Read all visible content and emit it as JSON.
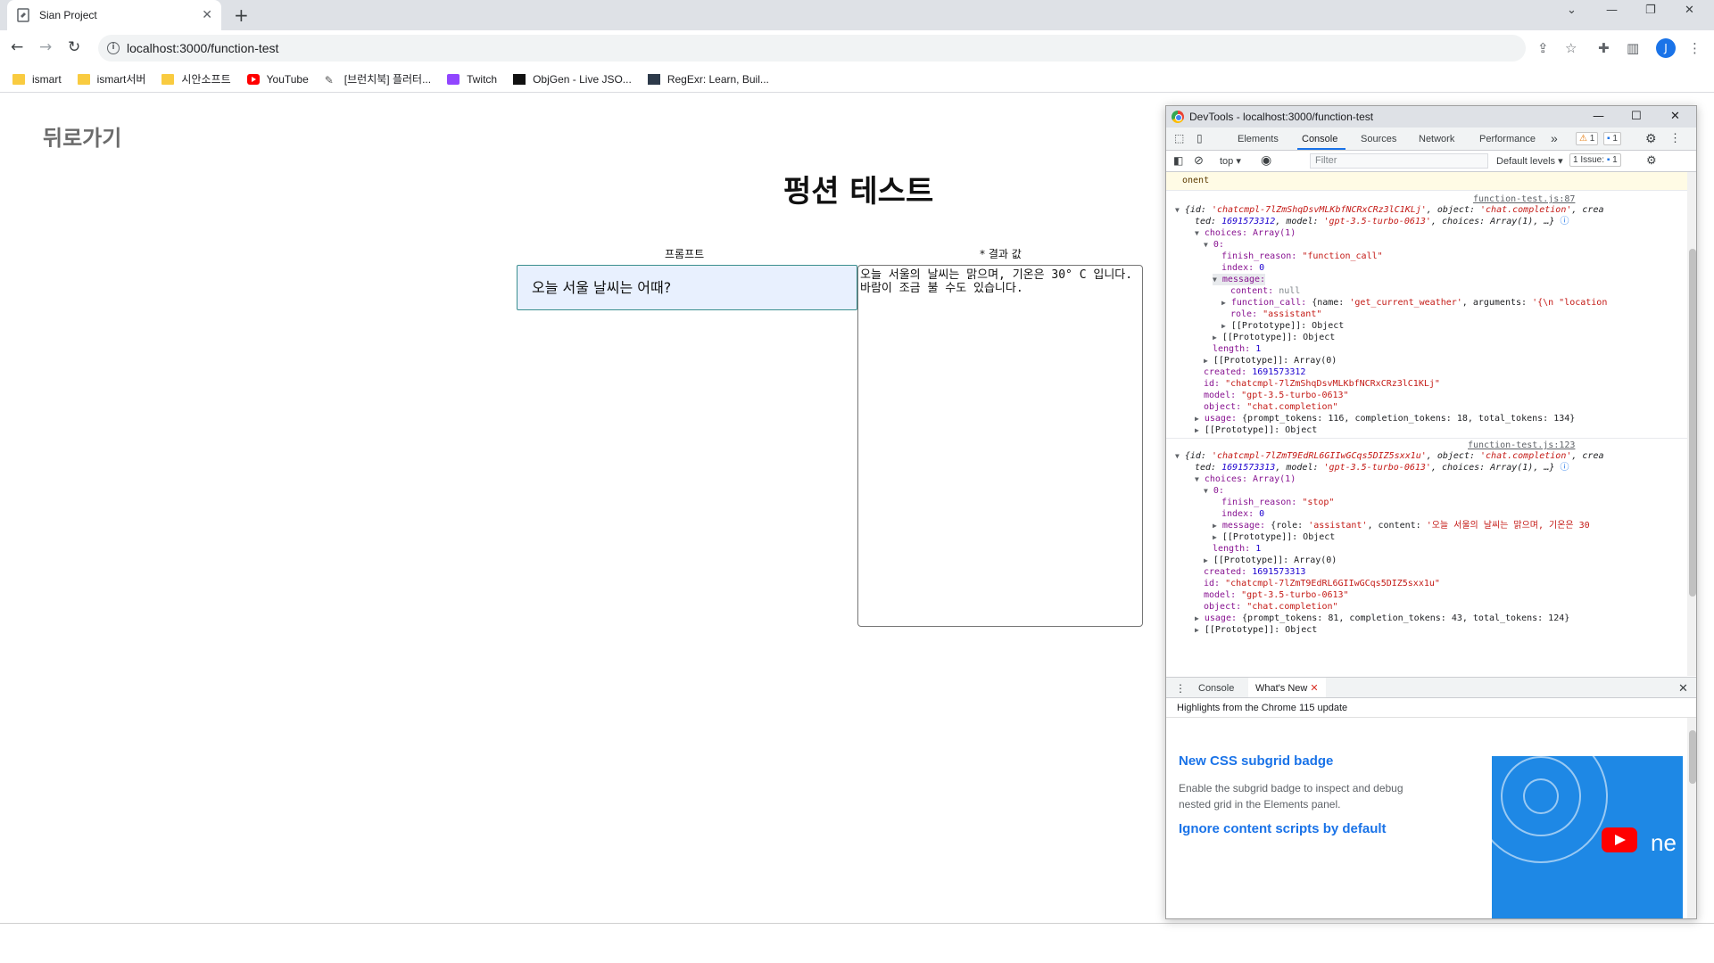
{
  "browser": {
    "tab_title": "Sian Project",
    "tab_close": "✕",
    "new_tab": "+",
    "url": "localhost:3000/function-test",
    "window_controls": [
      "⌄",
      "—",
      "❐",
      "✕"
    ],
    "toolbar_icons": [
      "share-icon",
      "star-icon",
      "extensions-icon",
      "side-panel-icon"
    ],
    "avatar_letter": "J",
    "menu": "⋮"
  },
  "bookmarks": [
    {
      "label": "ismart",
      "icon": "folder-icon"
    },
    {
      "label": "ismart서버",
      "icon": "folder-icon"
    },
    {
      "label": "시안소프트",
      "icon": "folder-icon"
    },
    {
      "label": "YouTube",
      "icon": "youtube-icon"
    },
    {
      "label": "[브런치북] 플러터...",
      "icon": "pen-icon"
    },
    {
      "label": "Twitch",
      "icon": "twitch-icon"
    },
    {
      "label": "ObjGen - Live JSO...",
      "icon": "objgen-icon"
    },
    {
      "label": "RegExr: Learn, Buil...",
      "icon": "regexr-icon"
    }
  ],
  "page": {
    "back_link": "뒤로가기",
    "title": "펑션 테스트",
    "prompt_label": "프롬프트",
    "result_label": "* 결과 값",
    "prompt_value": "오늘 서울 날씨는 어때?",
    "result_value": "오늘 서울의 날씨는 맑으며, 기온은 30° C 입니다. 바람이 조금 불 수도 있습니다."
  },
  "devtools": {
    "window_title": "DevTools - localhost:3000/function-test",
    "tabs": [
      "Elements",
      "Console",
      "Sources",
      "Network",
      "Performance"
    ],
    "active_tab": "Console",
    "more_tabs": "»",
    "warnings_count": "1",
    "messages_count": "1",
    "context": "top",
    "filter_placeholder": "Filter",
    "levels": "Default levels",
    "issues": "1 Issue:",
    "issues_count": "1",
    "console_top_fragment": "onent",
    "log1": {
      "source": "function-test.js:87",
      "summary_a": "{id: ",
      "summary_id": "'chatcmpl-7lZmShqDsvMLKbfNCRxCRz3lC1KLj'",
      "summary_b": ", object: ",
      "summary_obj": "'chat.completion'",
      "summary_c": ", crea",
      "summary_line2a": "ted: ",
      "summary_created": "1691573312",
      "summary_line2b": ", model: ",
      "summary_model": "'gpt-3.5-turbo-0613'",
      "summary_line2c": ", choices: Array(1), …}",
      "choices": "choices: Array(1)",
      "idx0": "0:",
      "finish_reason_key": "finish_reason:",
      "finish_reason": "\"function_call\"",
      "index_key": "index:",
      "index": "0",
      "message_key": "message:",
      "content_key": "content:",
      "content": "null",
      "function_call_key": "function_call:",
      "function_call_a": "{name: ",
      "function_call_name": "'get_current_weather'",
      "function_call_b": ", arguments: ",
      "function_call_args": "'{\\n  \"location",
      "role_key": "role:",
      "role": "\"assistant\"",
      "proto_object": "[[Prototype]]: Object",
      "length_key": "length:",
      "length": "1",
      "proto_array": "[[Prototype]]: Array(0)",
      "created_key": "created:",
      "created": "1691573312",
      "id_key": "id:",
      "id": "\"chatcmpl-7lZmShqDsvMLKbfNCRxCRz3lC1KLj\"",
      "model_key": "model:",
      "model": "\"gpt-3.5-turbo-0613\"",
      "object_key": "object:",
      "object": "\"chat.completion\"",
      "usage_key": "usage:",
      "usage": "{prompt_tokens: 116, completion_tokens: 18, total_tokens: 134}"
    },
    "log2": {
      "source": "function-test.js:123",
      "summary_a": "{id: ",
      "summary_id": "'chatcmpl-7lZmT9EdRL6GIIwGCqs5DIZ5sxx1u'",
      "summary_b": ", object: ",
      "summary_obj": "'chat.completion'",
      "summary_c": ", crea",
      "summary_line2a": "ted: ",
      "summary_created": "1691573313",
      "summary_line2b": ", model: ",
      "summary_model": "'gpt-3.5-turbo-0613'",
      "summary_line2c": ", choices: Array(1), …}",
      "choices": "choices: Array(1)",
      "idx0": "0:",
      "finish_reason_key": "finish_reason:",
      "finish_reason": "\"stop\"",
      "index_key": "index:",
      "index": "0",
      "message_key": "message:",
      "message_a": "{role: ",
      "message_role": "'assistant'",
      "message_b": ", content: ",
      "message_content": "'오늘 서울의 날씨는 맑으며, 기온은 30",
      "proto_object": "[[Prototype]]: Object",
      "length_key": "length:",
      "length": "1",
      "proto_array": "[[Prototype]]: Array(0)",
      "created_key": "created:",
      "created": "1691573313",
      "id_key": "id:",
      "id": "\"chatcmpl-7lZmT9EdRL6GIIwGCqs5DIZ5sxx1u\"",
      "model_key": "model:",
      "model": "\"gpt-3.5-turbo-0613\"",
      "object_key": "object:",
      "object": "\"chat.completion\"",
      "usage_key": "usage:",
      "usage": "{prompt_tokens: 81, completion_tokens: 43, total_tokens: 124}",
      "cut_off": "[[Prototype]]: Object"
    },
    "drawer": {
      "tab_console": "Console",
      "tab_whats_new": "What's New",
      "close": "✕",
      "header": "Highlights from the Chrome 115 update",
      "item1_title": "New CSS subgrid badge",
      "item1_text": "Enable the subgrid badge to inspect and debug nested grid in the Elements panel.",
      "item2_title": "Ignore content scripts by default",
      "thumb_text": "ne"
    }
  }
}
